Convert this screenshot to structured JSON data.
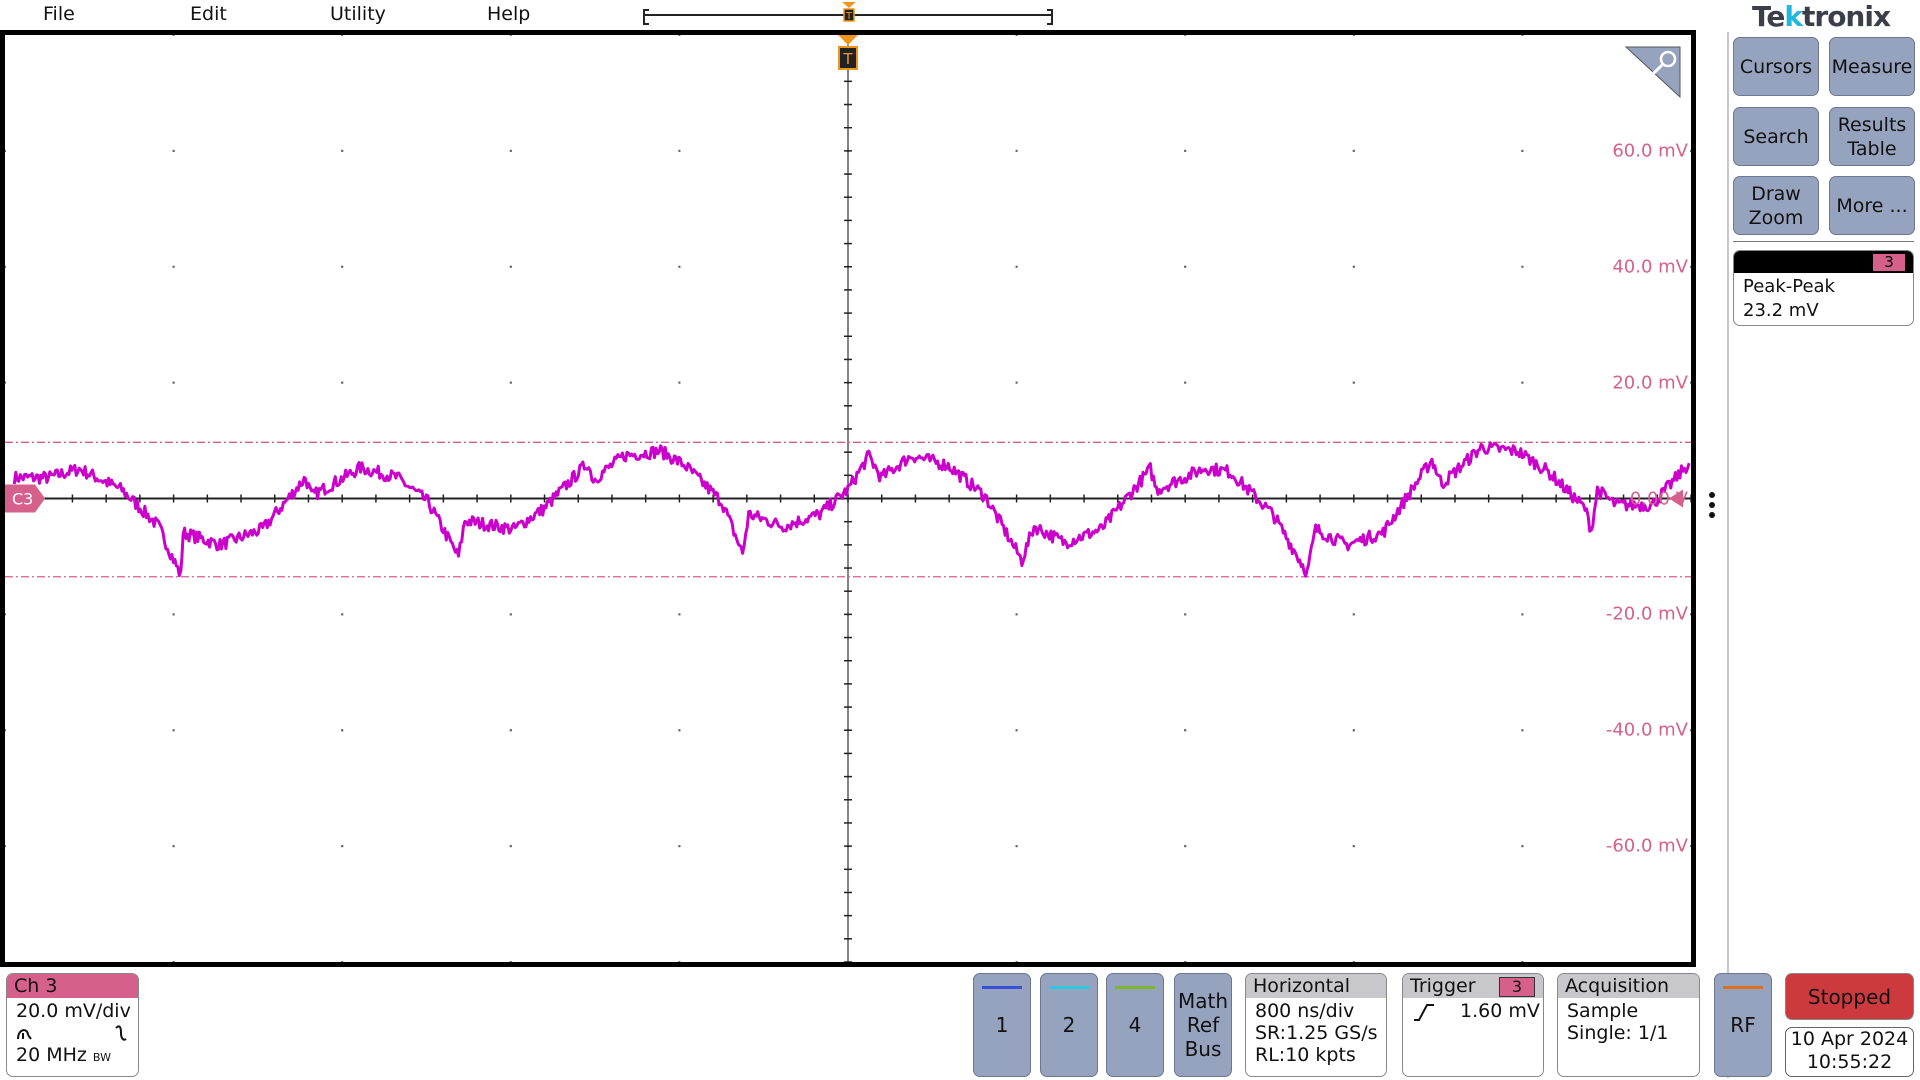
{
  "menu": {
    "items": [
      "File",
      "Edit",
      "Utility",
      "Help"
    ]
  },
  "brand": {
    "logo_text": "Tektronix"
  },
  "graticule": {
    "channel_marker": "C3",
    "y_labels": [
      "60.0 mV",
      "40.0 mV",
      "20.0 mV",
      "0.00 V",
      "-20.0 mV",
      "-40.0 mV",
      "-60.0 mV"
    ],
    "trigger_marker": "T"
  },
  "chart_data": {
    "type": "line",
    "xlabel": "",
    "ylabel": "",
    "x_unit": "µs",
    "y_unit": "mV",
    "xlim": [
      -4.0,
      4.0
    ],
    "ylim": [
      -80,
      80
    ],
    "x_divisions": 10,
    "y_divisions": 8,
    "grid": true,
    "series": [
      {
        "name": "C3",
        "color": "#cc00cc",
        "points": [
          [
            -3.956,
            3.6
          ],
          [
            -3.794,
            3.6
          ],
          [
            -3.648,
            5.1
          ],
          [
            -3.445,
            1.5
          ],
          [
            -3.271,
            -4.8
          ],
          [
            -3.166,
            -13.3
          ],
          [
            -3.155,
            -5.9
          ],
          [
            -2.98,
            -8.0
          ],
          [
            -2.777,
            -5.3
          ],
          [
            -2.574,
            3.6
          ],
          [
            -2.545,
            0.4
          ],
          [
            -2.313,
            5.3
          ],
          [
            -2.138,
            3.6
          ],
          [
            -1.993,
            -0.6
          ],
          [
            -1.848,
            -10.1
          ],
          [
            -1.818,
            -3.8
          ],
          [
            -1.586,
            -5.3
          ],
          [
            -1.441,
            -1.7
          ],
          [
            -1.237,
            6.1
          ],
          [
            -1.208,
            3.2
          ],
          [
            -1.063,
            7.4
          ],
          [
            -0.889,
            8.2
          ],
          [
            -0.773,
            5.7
          ],
          [
            -0.598,
            -0.6
          ],
          [
            -0.5,
            -9.5
          ],
          [
            -0.471,
            -2.7
          ],
          [
            -0.308,
            -4.8
          ],
          [
            -0.134,
            -2.7
          ],
          [
            0.0,
            1.5
          ],
          [
            0.099,
            7.4
          ],
          [
            0.157,
            3.6
          ],
          [
            0.302,
            7.4
          ],
          [
            0.476,
            5.7
          ],
          [
            0.651,
            0.4
          ],
          [
            0.825,
            -10.7
          ],
          [
            0.883,
            -4.8
          ],
          [
            1.028,
            -7.6
          ],
          [
            1.203,
            -5.3
          ],
          [
            1.435,
            5.1
          ],
          [
            1.464,
            1.5
          ],
          [
            1.696,
            5.3
          ],
          [
            1.813,
            4.6
          ],
          [
            2.016,
            -2.7
          ],
          [
            2.179,
            -12.8
          ],
          [
            2.219,
            -5.3
          ],
          [
            2.365,
            -8.0
          ],
          [
            2.539,
            -5.9
          ],
          [
            2.771,
            6.7
          ],
          [
            2.818,
            2.5
          ],
          [
            3.004,
            8.8
          ],
          [
            3.178,
            8.2
          ],
          [
            3.323,
            4.6
          ],
          [
            3.497,
            -1.7
          ],
          [
            3.527,
            -5.5
          ],
          [
            3.556,
            1.5
          ],
          [
            3.643,
            -1.1
          ],
          [
            3.817,
            -1.1
          ],
          [
            3.991,
            6.1
          ]
        ]
      }
    ],
    "measurement_lines_mV": {
      "max": 9.7,
      "min": -13.5,
      "color": "#d6608c"
    }
  },
  "side": {
    "buttons": [
      {
        "label": "Cursors"
      },
      {
        "label": "Measure"
      },
      {
        "label": "Search"
      },
      {
        "label": "Results Table"
      },
      {
        "label": "Draw Zoom"
      },
      {
        "label": "More ..."
      }
    ],
    "measurement": {
      "channel": "3",
      "name": "Peak-Peak",
      "value": "23.2 mV"
    }
  },
  "bottom": {
    "ch3": {
      "title": "Ch 3",
      "scale": "20.0 mV/div",
      "bandwidth": "20 MHz",
      "bw_mark": "BW"
    },
    "channels": [
      {
        "label": "1",
        "color": "#3a4fd8"
      },
      {
        "label": "2",
        "color": "#2ec8e0"
      },
      {
        "label": "4",
        "color": "#7ab82a"
      }
    ],
    "math_ref_bus": "Math Ref Bus",
    "horizontal": {
      "title": "Horizontal",
      "scale": "800 ns/div",
      "sample_rate": "SR:1.25 GS/s",
      "record_length": "RL:10 kpts"
    },
    "trigger": {
      "title": "Trigger",
      "source": "3",
      "level": "1.60 mV",
      "slope": "rising"
    },
    "acquisition": {
      "title": "Acquisition",
      "mode": "Sample",
      "count": "Single: 1/1"
    },
    "rf": {
      "label": "RF",
      "color": "#e07020"
    },
    "run_state": "Stopped",
    "date": "10 Apr 2024",
    "time": "10:55:22"
  },
  "colors": {
    "ch3": "#d6608c",
    "trace": "#cc00cc",
    "button": "#95a3bf",
    "stopped": "#cc3a3e",
    "trigger": "#f0961e"
  }
}
